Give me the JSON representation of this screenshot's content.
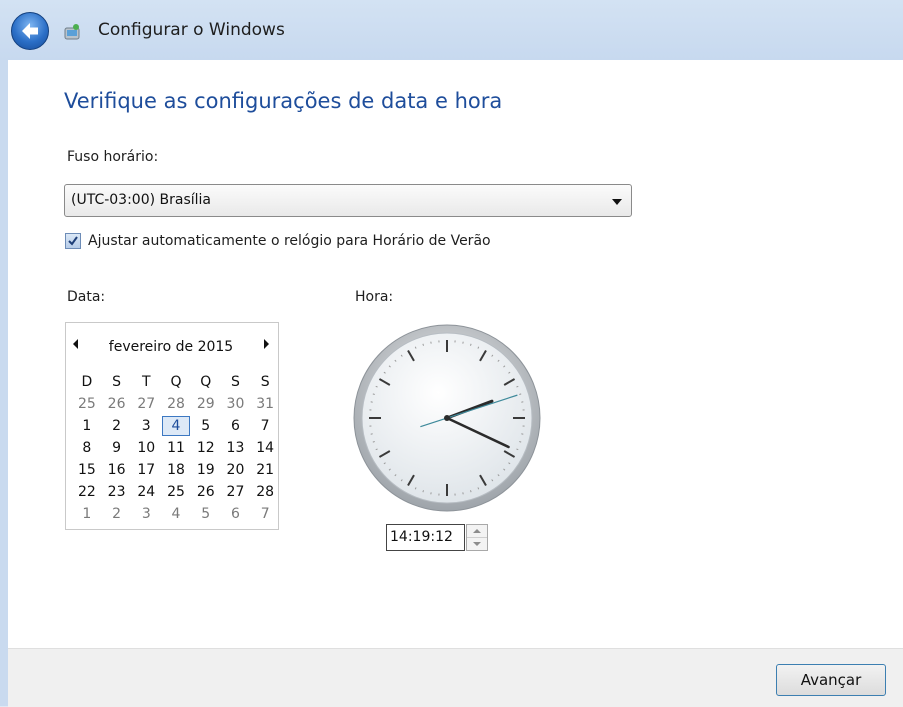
{
  "window": {
    "title": "Configurar o Windows"
  },
  "page": {
    "heading": "Verifique as configurações de data e hora"
  },
  "timezone": {
    "label": "Fuso horário:",
    "selected": "(UTC-03:00) Brasília"
  },
  "dst": {
    "label": "Ajustar automaticamente o relógio para Horário de Verão",
    "checked": true
  },
  "date": {
    "label": "Data:",
    "month_label": "fevereiro de 2015",
    "weekdays": [
      "D",
      "S",
      "T",
      "Q",
      "Q",
      "S",
      "S"
    ],
    "weeks": [
      [
        "25",
        "26",
        "27",
        "28",
        "29",
        "30",
        "31"
      ],
      [
        "1",
        "2",
        "3",
        "4",
        "5",
        "6",
        "7"
      ],
      [
        "8",
        "9",
        "10",
        "11",
        "12",
        "13",
        "14"
      ],
      [
        "15",
        "16",
        "17",
        "18",
        "19",
        "20",
        "21"
      ],
      [
        "22",
        "23",
        "24",
        "25",
        "26",
        "27",
        "28"
      ],
      [
        "1",
        "2",
        "3",
        "4",
        "5",
        "6",
        "7"
      ]
    ],
    "selected_day": "4"
  },
  "time": {
    "label": "Hora:",
    "value": "14:19:12"
  },
  "footer": {
    "next_label": "Avançar"
  }
}
